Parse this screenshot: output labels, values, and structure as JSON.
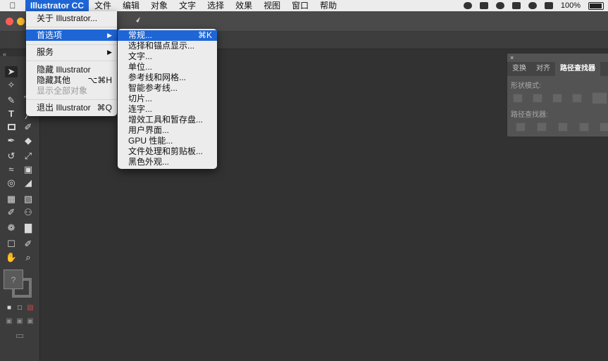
{
  "menubar": {
    "apple_icon": "apple-icon",
    "items": [
      "Illustrator CC",
      "文件",
      "编辑",
      "对象",
      "文字",
      "选择",
      "效果",
      "视图",
      "窗口",
      "帮助"
    ],
    "status": {
      "battery": "100%"
    }
  },
  "app_menu": {
    "items": [
      {
        "label": "关于 Illustrator...",
        "shortcut": ""
      },
      {
        "label": "首选项",
        "shortcut": "▶"
      },
      {
        "label": "服务",
        "shortcut": "▶"
      },
      {
        "label": "隐藏 Illustrator",
        "shortcut": ""
      },
      {
        "label": "隐藏其他",
        "shortcut": "⌥⌘H"
      },
      {
        "label": "显示全部对象",
        "shortcut": ""
      },
      {
        "label": "退出 Illustrator",
        "shortcut": "⌘Q"
      }
    ]
  },
  "pref_menu": {
    "items": [
      {
        "label": "常规...",
        "shortcut": "⌘K"
      },
      {
        "label": "选择和锚点显示...",
        "shortcut": ""
      },
      {
        "label": "文字...",
        "shortcut": ""
      },
      {
        "label": "单位...",
        "shortcut": ""
      },
      {
        "label": "参考线和网格...",
        "shortcut": ""
      },
      {
        "label": "智能参考线...",
        "shortcut": ""
      },
      {
        "label": "切片...",
        "shortcut": ""
      },
      {
        "label": "连字...",
        "shortcut": ""
      },
      {
        "label": "增效工具和暂存盘...",
        "shortcut": ""
      },
      {
        "label": "用户界面...",
        "shortcut": ""
      },
      {
        "label": "GPU 性能...",
        "shortcut": ""
      },
      {
        "label": "文件处理和剪贴板...",
        "shortcut": ""
      },
      {
        "label": "黑色外观...",
        "shortcut": ""
      }
    ]
  },
  "panel": {
    "close": "×",
    "tabs": [
      "变换",
      "对齐",
      "路径查找器"
    ],
    "shape_modes_label": "形状模式:",
    "pathfinders_label": "路径查找器:"
  },
  "tools": {
    "collapse": "«",
    "color_unknown": "?"
  },
  "colors": {
    "menu_highlight": "#1e66d6",
    "menu_bg": "#ececec",
    "canvas": "#323232",
    "panel": "#535353"
  }
}
